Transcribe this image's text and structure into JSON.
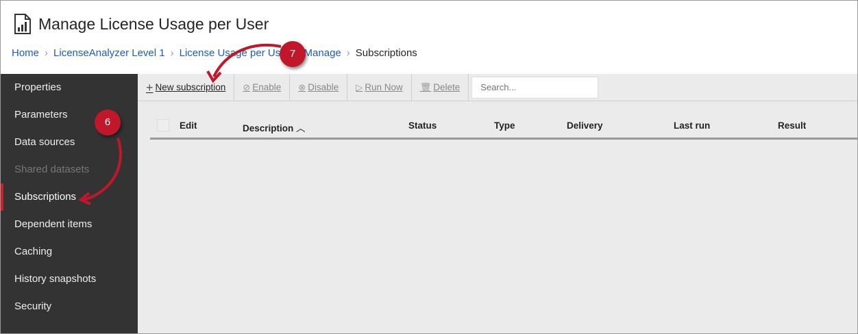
{
  "title": "Manage License Usage per User",
  "breadcrumb": [
    "Home",
    "LicenseAnalyzer Level 1",
    "License Usage per User",
    "Manage",
    "Subscriptions"
  ],
  "sidebar": {
    "items": [
      {
        "label": "Properties"
      },
      {
        "label": "Parameters"
      },
      {
        "label": "Data sources"
      },
      {
        "label": "Shared datasets"
      },
      {
        "label": "Subscriptions"
      },
      {
        "label": "Dependent items"
      },
      {
        "label": "Caching"
      },
      {
        "label": "History snapshots"
      },
      {
        "label": "Security"
      }
    ]
  },
  "toolbar": {
    "new": "New subscription",
    "enable": "Enable",
    "disable": "Disable",
    "run": "Run Now",
    "delete": "Delete",
    "search_placeholder": "Search..."
  },
  "table": {
    "columns": [
      "Edit",
      "Description",
      "Status",
      "Type",
      "Delivery",
      "Last run",
      "Result"
    ]
  },
  "annotations": {
    "step6": "6",
    "step7": "7"
  },
  "colors": {
    "accent": "#c0182a",
    "link": "#1a5cc8",
    "sidebar": "#333333"
  }
}
